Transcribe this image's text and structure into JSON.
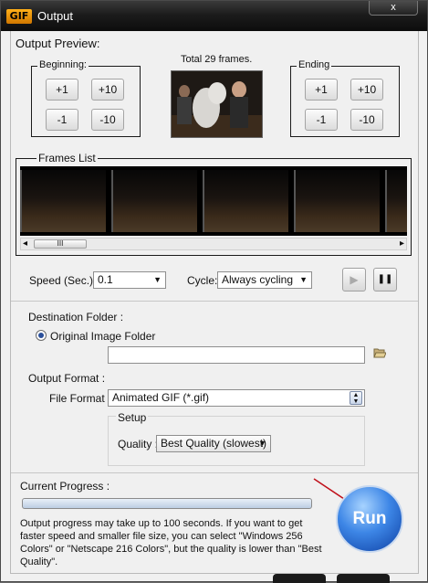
{
  "window": {
    "title": "Output",
    "logo_text": "GIF",
    "close_label": "x"
  },
  "preview": {
    "heading": "Output Preview:",
    "total_frames": "Total 29 frames.",
    "beginning": {
      "legend": "Beginning:",
      "buttons": [
        "+1",
        "+10",
        "-1",
        "-10"
      ]
    },
    "ending": {
      "legend": "Ending",
      "buttons": [
        "+1",
        "+10",
        "-1",
        "-10"
      ]
    }
  },
  "frames_list": {
    "heading": "Frames List",
    "scroll_left_icon": "◂",
    "scroll_right_icon": "▸",
    "scroll_grip": "III"
  },
  "speed": {
    "label": "Speed (Sec.):",
    "value": "0.1"
  },
  "cycle": {
    "label": "Cycle:",
    "value": "Always cycling"
  },
  "playback": {
    "play_icon": "▶",
    "pause_icon": "❚❚"
  },
  "destination": {
    "heading": "Destination Folder :",
    "radio_label": "Original Image Folder",
    "path_value": ""
  },
  "output_format": {
    "heading": "Output Format :",
    "file_format_label": "File Format",
    "file_format_value": "Animated GIF (*.gif)",
    "setup_heading": "Setup",
    "quality_label": "Quality :",
    "quality_value": "Best Quality (slowest)"
  },
  "progress": {
    "heading": "Current Progress :",
    "fraction": 0.0,
    "note": "Output progress may take up to 100 seconds. If you want to get faster speed and smaller file size, you can select \"Windows 256 Colors\" or \"Netscape 216 Colors\", but the quality is lower than \"Best Quality\"."
  },
  "run": {
    "label": "Run"
  },
  "colors": {
    "titlebar": "#111111",
    "run_button": "#2f76dc",
    "arrow": "#c0101a"
  }
}
